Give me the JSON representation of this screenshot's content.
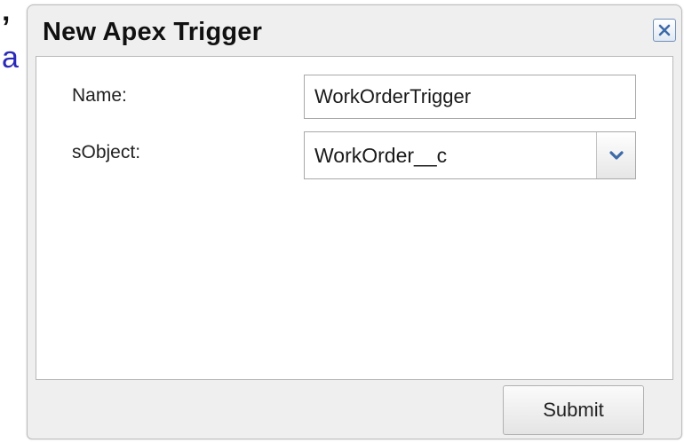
{
  "background": {
    "fragment_top": "’",
    "fragment_link": "a",
    "link_color": "#2a2ab8"
  },
  "dialog": {
    "title": "New Apex Trigger",
    "close_icon": "close-icon",
    "fields": {
      "name_label": "Name:",
      "name_value": "WorkOrderTrigger",
      "sobject_label": "sObject:",
      "sobject_selected": "WorkOrder__c",
      "dropdown_icon": "chevron-down-icon"
    },
    "submit_label": "Submit"
  },
  "colors": {
    "dialog_bg": "#efefef",
    "close_icon": "#3d6aa8",
    "chevron": "#3d6aa8"
  }
}
